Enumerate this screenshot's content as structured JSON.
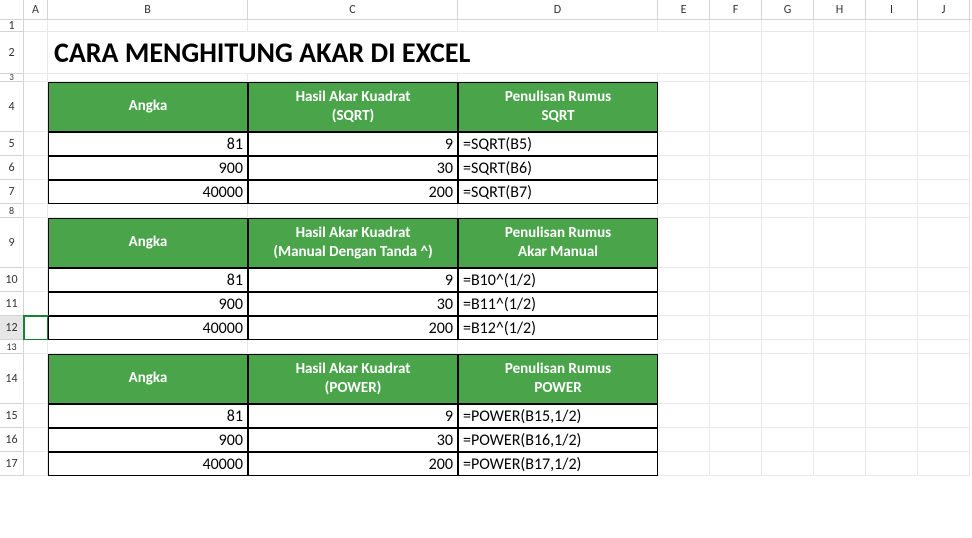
{
  "title": "CARA MENGHITUNG AKAR DI EXCEL",
  "columns": [
    "A",
    "B",
    "C",
    "D",
    "E",
    "F",
    "G",
    "H",
    "I",
    "J"
  ],
  "rows": [
    "1",
    "2",
    "3",
    "4",
    "5",
    "6",
    "7",
    "8",
    "9",
    "10",
    "11",
    "12",
    "13",
    "14",
    "15",
    "16",
    "17"
  ],
  "table1": {
    "h1": "Angka",
    "h2a": "Hasil Akar Kuadrat",
    "h2b": "(SQRT)",
    "h3a": "Penulisan Rumus",
    "h3b": "SQRT",
    "rows": [
      {
        "a": "81",
        "b": "9",
        "c": "=SQRT(B5)"
      },
      {
        "a": "900",
        "b": "30",
        "c": "=SQRT(B6)"
      },
      {
        "a": "40000",
        "b": "200",
        "c": "=SQRT(B7)"
      }
    ]
  },
  "table2": {
    "h1": "Angka",
    "h2a": "Hasil Akar Kuadrat",
    "h2b": "(Manual Dengan Tanda ^)",
    "h3a": "Penulisan Rumus",
    "h3b": "Akar Manual",
    "rows": [
      {
        "a": "81",
        "b": "9",
        "c": "=B10^(1/2)"
      },
      {
        "a": "900",
        "b": "30",
        "c": "=B11^(1/2)"
      },
      {
        "a": "40000",
        "b": "200",
        "c": "=B12^(1/2)"
      }
    ]
  },
  "table3": {
    "h1": "Angka",
    "h2a": "Hasil Akar Kuadrat",
    "h2b": "(POWER)",
    "h3a": "Penulisan Rumus",
    "h3b": "POWER",
    "rows": [
      {
        "a": "81",
        "b": "9",
        "c": "=POWER(B15,1/2)"
      },
      {
        "a": "900",
        "b": "30",
        "c": "=POWER(B16,1/2)"
      },
      {
        "a": "40000",
        "b": "200",
        "c": "=POWER(B17,1/2)"
      }
    ]
  }
}
